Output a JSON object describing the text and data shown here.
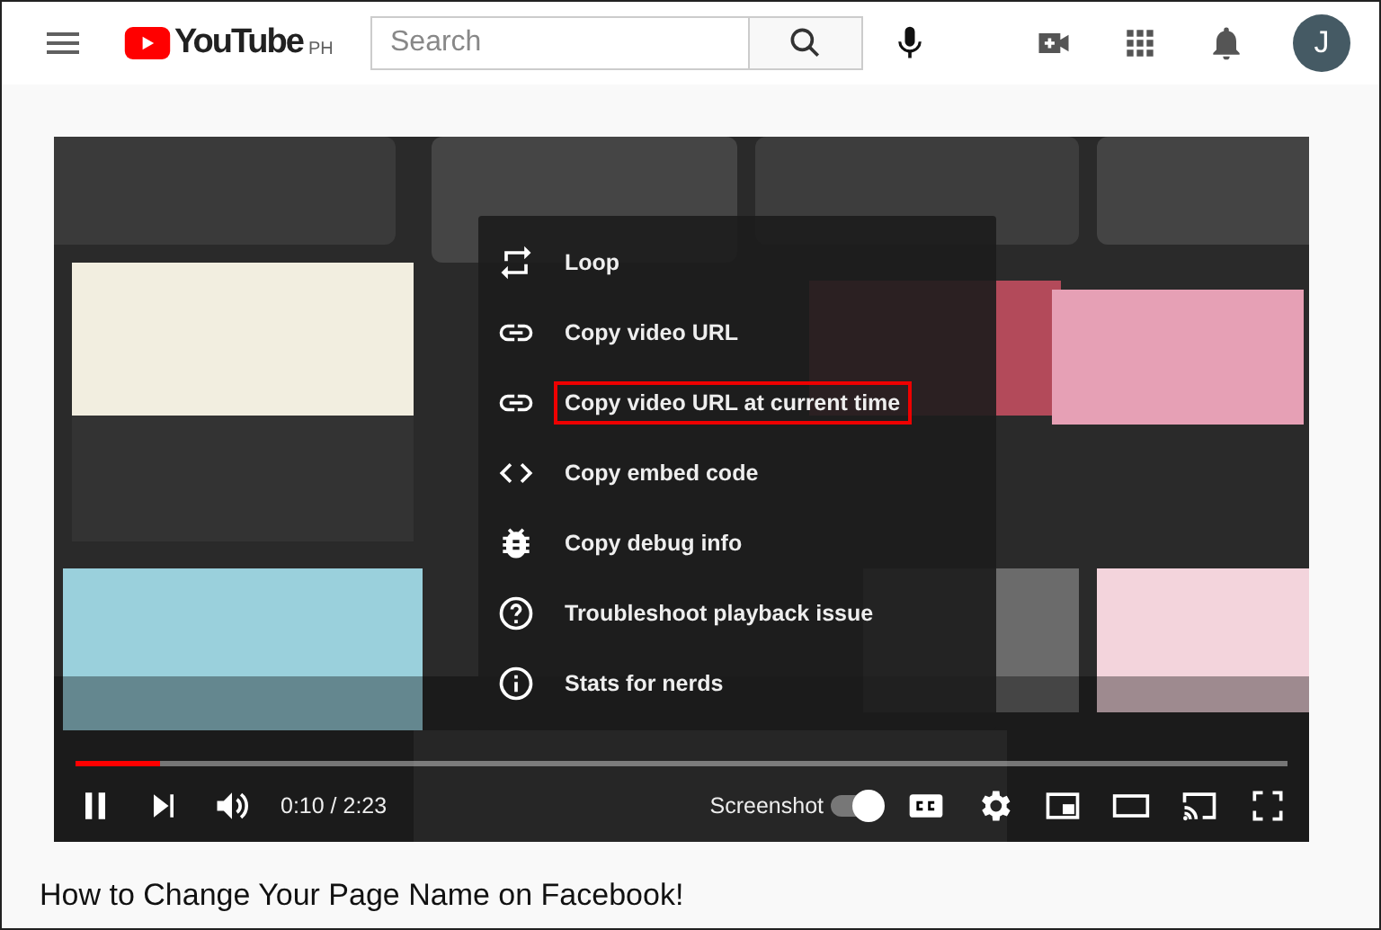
{
  "header": {
    "logo": "YouTube",
    "region": "PH",
    "search": {
      "placeholder": "Search"
    },
    "avatar": "J"
  },
  "player": {
    "progress": {
      "level": 0.07
    },
    "time": "0:10 / 2:23",
    "screenshot": {
      "label": "Screenshot",
      "on": true
    },
    "menu": [
      {
        "label": "Loop",
        "highlighted": false
      },
      {
        "label": "Copy video URL",
        "highlighted": false
      },
      {
        "label": "Copy video URL at current time",
        "highlighted": true
      },
      {
        "label": "Copy embed code",
        "highlighted": false
      },
      {
        "label": "Copy debug info",
        "highlighted": false
      },
      {
        "label": "Troubleshoot playback issue",
        "highlighted": false
      },
      {
        "label": "Stats for nerds",
        "highlighted": false
      }
    ]
  },
  "video_title": "How to Change Your Page Name on Facebook!"
}
